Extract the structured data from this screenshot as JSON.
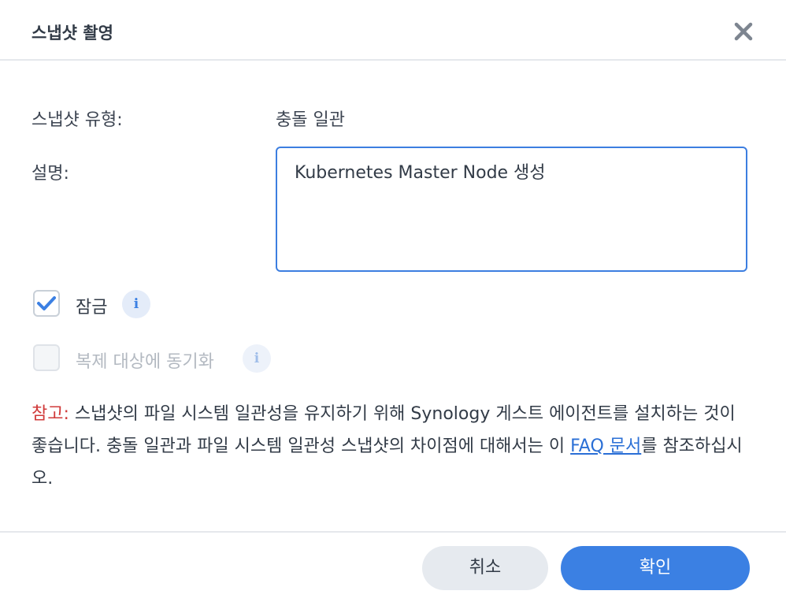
{
  "dialog": {
    "title": "스냅샷 촬영",
    "close_icon": "close-icon"
  },
  "form": {
    "snapshot_type_label": "스냅샷 유형:",
    "snapshot_type_value": "충돌 일관",
    "description_label": "설명:",
    "description_value": "Kubernetes Master Node 생성"
  },
  "options": {
    "lock": {
      "label": "잠금",
      "checked": true,
      "info_icon": "info-icon"
    },
    "sync": {
      "label": "복제 대상에 동기화",
      "checked": false,
      "disabled": true,
      "info_icon": "info-icon"
    }
  },
  "note": {
    "prefix": "참고:",
    "text_before_link": " 스냅샷의 파일 시스템 일관성을 유지하기 위해 Synology 게스트 에이전트를 설치하는 것이 좋습니다. 충돌 일관과 파일 시스템 일관성 스냅샷의 차이점에 대해서는 이 ",
    "link": "FAQ 문서",
    "text_after_link": "를 참조하십시오."
  },
  "buttons": {
    "cancel": "취소",
    "confirm": "확인"
  },
  "colors": {
    "accent": "#3b80e3",
    "note_prefix": "#d03a3a",
    "link": "#2a6fd6"
  }
}
